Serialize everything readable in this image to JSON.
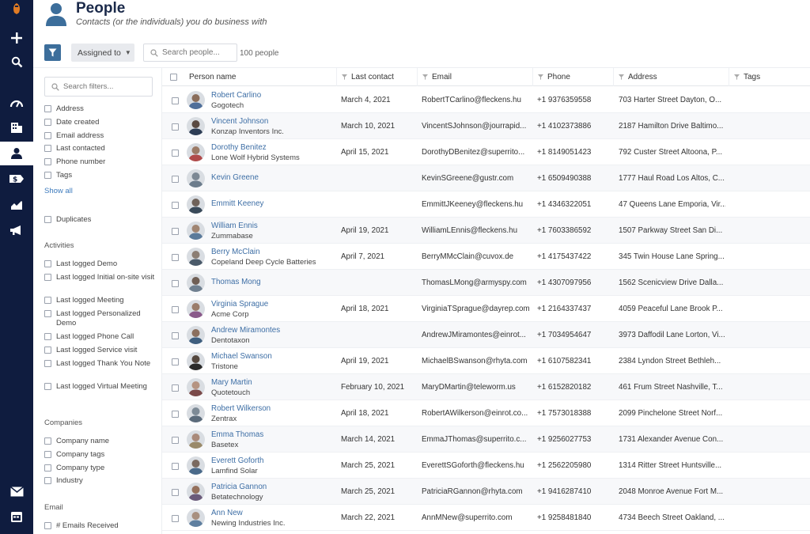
{
  "header": {
    "title": "People",
    "subtitle": "Contacts (or the individuals) you do business with"
  },
  "toolbar": {
    "assigned_label": "Assigned to",
    "search_placeholder": "Search people...",
    "count_label": "100 people"
  },
  "filters": {
    "search_placeholder": "Search filters...",
    "contact_fields": [
      "Address",
      "Date created",
      "Email address",
      "Last contacted",
      "Phone number",
      "Tags"
    ],
    "show_all": "Show all",
    "duplicates": "Duplicates",
    "activities_title": "Activities",
    "activities": [
      "Last logged Demo",
      "Last logged Initial on-site visit",
      "Last logged Meeting",
      "Last logged Personalized Demo",
      "Last logged Phone Call",
      "Last logged Service visit",
      "Last logged Thank You Note",
      "Last logged Virtual Meeting"
    ],
    "companies_title": "Companies",
    "companies": [
      "Company name",
      "Company tags",
      "Company type",
      "Industry"
    ],
    "email_title": "Email",
    "email": [
      "# Emails Received"
    ]
  },
  "table": {
    "columns": {
      "name": "Person name",
      "last_contact": "Last contact",
      "email": "Email",
      "phone": "Phone",
      "address": "Address",
      "tags": "Tags"
    },
    "rows": [
      {
        "name": "Robert Carlino",
        "company": "Gogotech",
        "last_contact": "March 4, 2021",
        "email": "RobertTCarlino@fleckens.hu",
        "phone": "+1 9376359558",
        "address": "703 Harter Street Dayton, O..."
      },
      {
        "name": "Vincent Johnson",
        "company": "Konzap Inventors Inc.",
        "last_contact": "March 10, 2021",
        "email": "VincentSJohnson@jourrapid...",
        "phone": "+1 4102373886",
        "address": "2187 Hamilton Drive Baltimo..."
      },
      {
        "name": "Dorothy Benitez",
        "company": "Lone Wolf Hybrid Systems",
        "last_contact": "April 15, 2021",
        "email": "DorothyDBenitez@superrito...",
        "phone": "+1 8149051423",
        "address": "792 Custer Street Altoona, P..."
      },
      {
        "name": "Kevin Greene",
        "company": "",
        "last_contact": "",
        "email": "KevinSGreene@gustr.com",
        "phone": "+1 6509490388",
        "address": "1777 Haul Road Los Altos, C..."
      },
      {
        "name": "Emmitt Keeney",
        "company": "",
        "last_contact": "",
        "email": "EmmittJKeeney@fleckens.hu",
        "phone": "+1 4346322051",
        "address": "47 Queens Lane Emporia, Vir..."
      },
      {
        "name": "William Ennis",
        "company": "Zummabase",
        "last_contact": "April 19, 2021",
        "email": "WilliamLEnnis@fleckens.hu",
        "phone": "+1 7603386592",
        "address": "1507 Parkway Street San Di..."
      },
      {
        "name": "Berry McClain",
        "company": "Copeland Deep Cycle Batteries",
        "last_contact": "April 7, 2021",
        "email": "BerryMMcClain@cuvox.de",
        "phone": "+1 4175437422",
        "address": "345 Twin House Lane Spring..."
      },
      {
        "name": "Thomas Mong",
        "company": "",
        "last_contact": "",
        "email": "ThomasLMong@armyspy.com",
        "phone": "+1 4307097956",
        "address": "1562 Scenicview Drive Dalla..."
      },
      {
        "name": "Virginia Sprague",
        "company": "Acme Corp",
        "last_contact": "April 18, 2021",
        "email": "VirginiaTSprague@dayrep.com",
        "phone": "+1 2164337437",
        "address": "4059 Peaceful Lane Brook P..."
      },
      {
        "name": "Andrew Miramontes",
        "company": "Dentotaxon",
        "last_contact": "",
        "email": "AndrewJMiramontes@einrot...",
        "phone": "+1 7034954647",
        "address": "3973 Daffodil Lane Lorton, Vi..."
      },
      {
        "name": "Michael Swanson",
        "company": "Tristone",
        "last_contact": "April 19, 2021",
        "email": "MichaelBSwanson@rhyta.com",
        "phone": "+1 6107582341",
        "address": "2384 Lyndon Street Bethleh..."
      },
      {
        "name": "Mary Martin",
        "company": "Quotetouch",
        "last_contact": "February 10, 2021",
        "email": "MaryDMartin@teleworm.us",
        "phone": "+1 6152820182",
        "address": "461 Frum Street Nashville, T..."
      },
      {
        "name": "Robert Wilkerson",
        "company": "Zentrax",
        "last_contact": "April 18, 2021",
        "email": "RobertAWilkerson@einrot.co...",
        "phone": "+1 7573018388",
        "address": "2099 Pinchelone Street Norf..."
      },
      {
        "name": "Emma Thomas",
        "company": "Basetex",
        "last_contact": "March 14, 2021",
        "email": "EmmaJThomas@superrito.c...",
        "phone": "+1 9256027753",
        "address": "1731 Alexander Avenue Con..."
      },
      {
        "name": "Everett Goforth",
        "company": "Lamfind Solar",
        "last_contact": "March 25, 2021",
        "email": "EverettSGoforth@fleckens.hu",
        "phone": "+1 2562205980",
        "address": "1314 Ritter Street Huntsville..."
      },
      {
        "name": "Patricia Gannon",
        "company": "Betatechnology",
        "last_contact": "March 25, 2021",
        "email": "PatriciaRGannon@rhyta.com",
        "phone": "+1 9416287410",
        "address": "2048 Monroe Avenue Fort M..."
      },
      {
        "name": "Ann New",
        "company": "Newing Industries Inc.",
        "last_contact": "March 22, 2021",
        "email": "AnnMNew@superrito.com",
        "phone": "+1 9258481840",
        "address": "4734 Beech Street Oakland, ..."
      }
    ]
  },
  "colors": {
    "nav_background": "#0f1c3f",
    "accent": "#3c6e9b",
    "link": "#3d6ea5",
    "email_link": "#4f8ec7",
    "logo": "#e07b24"
  },
  "icons": [
    "logo-icon",
    "plus-icon",
    "search-icon",
    "dashboard-icon",
    "building-icon",
    "person-icon",
    "dollar-icon",
    "chart-icon",
    "megaphone-icon",
    "mail-icon",
    "calendar-icon",
    "filter-icon"
  ]
}
